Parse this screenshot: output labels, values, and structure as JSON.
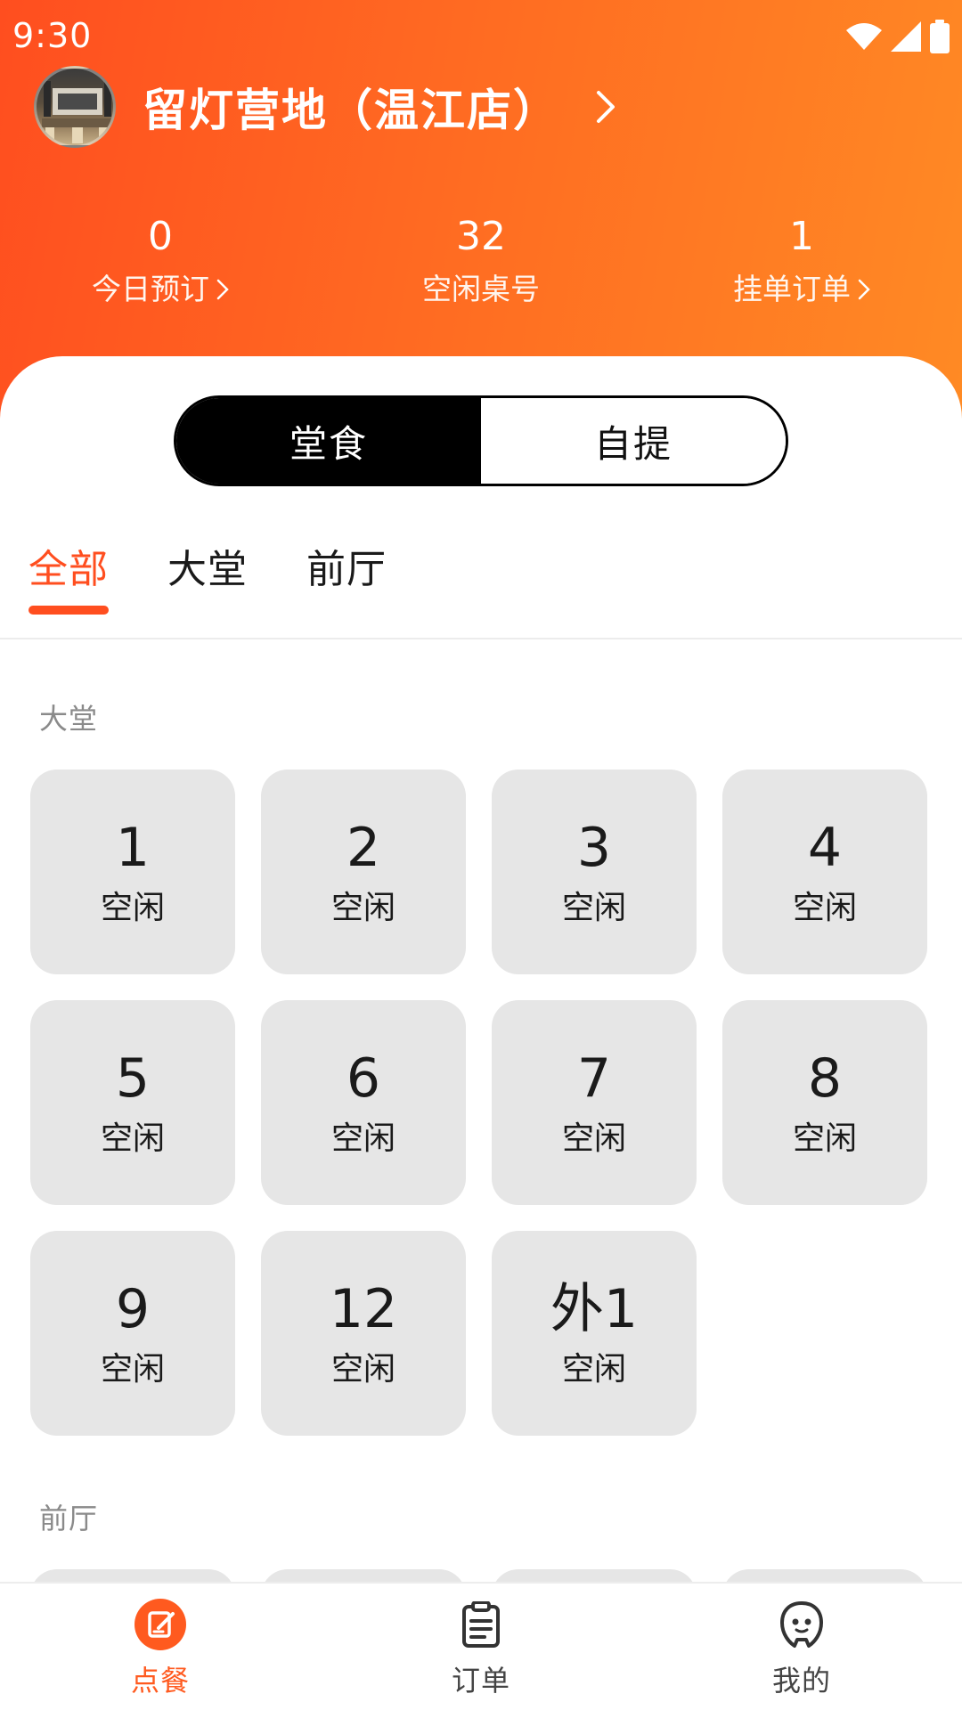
{
  "status_bar": {
    "time": "9:30"
  },
  "store": {
    "name": "留灯营地（温江店）"
  },
  "stats": [
    {
      "value": "0",
      "label": "今日预订"
    },
    {
      "value": "32",
      "label": "空闲桌号"
    },
    {
      "value": "1",
      "label": "挂单订单"
    }
  ],
  "mode_toggle": {
    "dine_in": "堂食",
    "pickup": "自提",
    "selected": "堂食"
  },
  "area_tabs": {
    "all": "全部",
    "hall": "大堂",
    "front": "前厅",
    "selected": "全部"
  },
  "sections": {
    "hall": {
      "title": "大堂",
      "tables": [
        {
          "number": "1",
          "status": "空闲"
        },
        {
          "number": "2",
          "status": "空闲"
        },
        {
          "number": "3",
          "status": "空闲"
        },
        {
          "number": "4",
          "status": "空闲"
        },
        {
          "number": "5",
          "status": "空闲"
        },
        {
          "number": "6",
          "status": "空闲"
        },
        {
          "number": "7",
          "status": "空闲"
        },
        {
          "number": "8",
          "status": "空闲"
        },
        {
          "number": "9",
          "status": "空闲"
        },
        {
          "number": "12",
          "status": "空闲"
        },
        {
          "number": "外1",
          "status": "空闲"
        }
      ]
    },
    "front": {
      "title": "前厅"
    }
  },
  "bottom_nav": {
    "order_food": "点餐",
    "orders": "订单",
    "mine": "我的",
    "selected": "点餐"
  },
  "colors": {
    "accent": "#ff4e1f",
    "header_gradient_end": "#ff8a24",
    "card_bg": "#e6e6e6"
  }
}
